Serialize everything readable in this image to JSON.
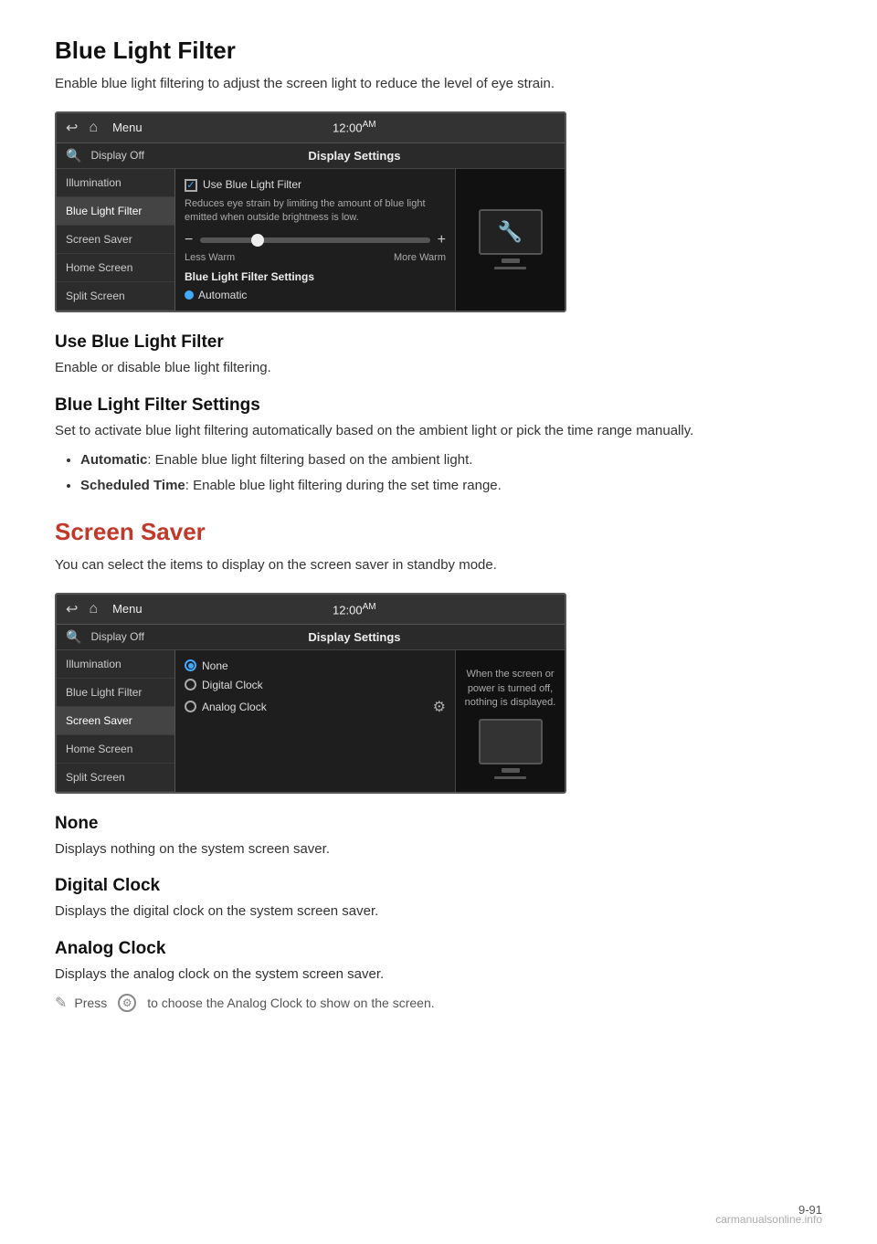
{
  "page": {
    "number": "9-91",
    "watermark": "carmanualsonline.info"
  },
  "section1": {
    "title": "Blue Light Filter",
    "intro": "Enable blue light filtering to adjust the screen light to reduce the level of eye strain.",
    "panel1": {
      "topbar": {
        "menu": "Menu",
        "time": "12:00",
        "am": "AM"
      },
      "subbar": {
        "display_off": "Display Off",
        "display_settings": "Display Settings"
      },
      "sidebar_items": [
        "Illumination",
        "Blue Light Filter",
        "Screen Saver",
        "Home Screen",
        "Split Screen"
      ],
      "active_item": "Blue Light Filter",
      "content": {
        "checkbox_label": "Use Blue Light Filter",
        "checkbox_desc": "Reduces eye strain by limiting the amount of blue light emitted when outside brightness is low.",
        "slider_less": "Less Warm",
        "slider_more": "More Warm",
        "settings_label": "Blue Light Filter Settings",
        "automatic_label": "Automatic"
      }
    },
    "sub1": {
      "title": "Use Blue Light Filter",
      "desc": "Enable or disable blue light filtering."
    },
    "sub2": {
      "title": "Blue Light Filter Settings",
      "desc": "Set to activate blue light filtering automatically based on the ambient light or pick the time range manually.",
      "bullets": [
        {
          "bold": "Automatic",
          "rest": ": Enable blue light filtering based on the ambient light."
        },
        {
          "bold": "Scheduled Time",
          "rest": ": Enable blue light filtering during the set time range."
        }
      ]
    }
  },
  "section2": {
    "title": "Screen Saver",
    "intro": "You can select the items to display on the screen saver in standby mode.",
    "panel2": {
      "topbar": {
        "menu": "Menu",
        "time": "12:00",
        "am": "AM"
      },
      "subbar": {
        "display_off": "Display Off",
        "display_settings": "Display Settings"
      },
      "sidebar_items": [
        "Illumination",
        "Blue Light Filter",
        "Screen Saver",
        "Home Screen",
        "Split Screen"
      ],
      "active_item": "Screen Saver",
      "content": {
        "radio_none": "None",
        "radio_digital": "Digital Clock",
        "radio_analog": "Analog Clock"
      },
      "right_note": "When the screen or power is turned off, nothing is displayed."
    },
    "sub1": {
      "title": "None",
      "desc": "Displays nothing on the system screen saver."
    },
    "sub2": {
      "title": "Digital Clock",
      "desc": "Displays the digital clock on the system screen saver."
    },
    "sub3": {
      "title": "Analog Clock",
      "desc": "Displays the analog clock on the system screen saver."
    },
    "note": "Press",
    "note2": "to choose the Analog Clock to show on the screen."
  }
}
